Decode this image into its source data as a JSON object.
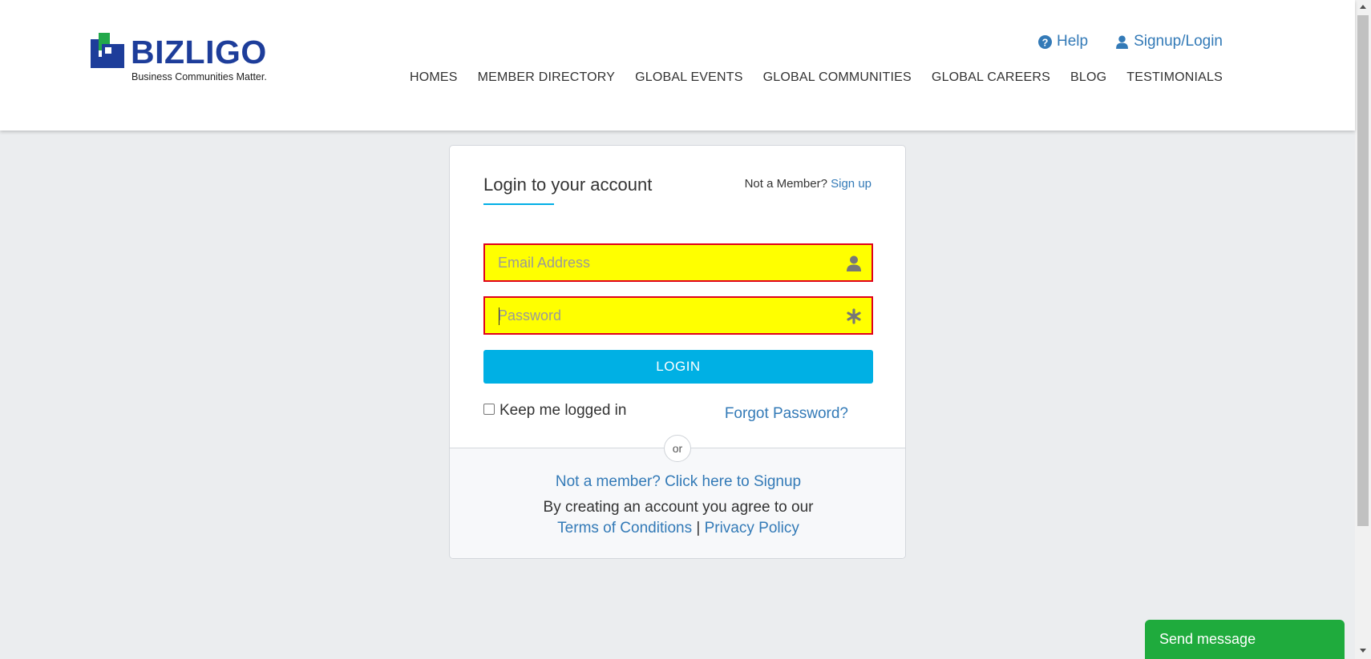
{
  "header": {
    "logo": {
      "wordmark": "BIZLIGO",
      "tagline": "Business Communities Matter."
    },
    "top_links": {
      "help": "Help",
      "signup_login": "Signup/Login"
    },
    "nav": [
      "HOMES",
      "MEMBER DIRECTORY",
      "GLOBAL EVENTS",
      "GLOBAL COMMUNITIES",
      "GLOBAL CAREERS",
      "BLOG",
      "TESTIMONIALS"
    ]
  },
  "login_card": {
    "title": "Login to your account",
    "not_member_text": "Not a Member?",
    "signup_link": "Sign up",
    "email": {
      "value": "",
      "placeholder": "Email Address",
      "icon": "user-icon"
    },
    "password": {
      "value": "",
      "placeholder": "Password",
      "icon": "asterisk-icon"
    },
    "login_button": "LOGIN",
    "keep_logged_in": {
      "label": "Keep me logged in",
      "checked": false
    },
    "forgot_password": "Forgot Password?",
    "or_label": "or",
    "signup_prompt": "Not a member? Click here to Signup",
    "agree_text": "By creating an account you agree to our",
    "terms_link": "Terms of Conditions",
    "separator": "|",
    "privacy_link": "Privacy Policy"
  },
  "chat_widget": {
    "label": "Send message"
  },
  "colors": {
    "brand_blue": "#1d3d9a",
    "brand_green": "#22a84a",
    "accent_cyan": "#00b0e4",
    "link_blue": "#337ab7",
    "field_highlight": "#ffff00",
    "field_border": "#e0001b",
    "chat_green": "#1fab3d"
  }
}
